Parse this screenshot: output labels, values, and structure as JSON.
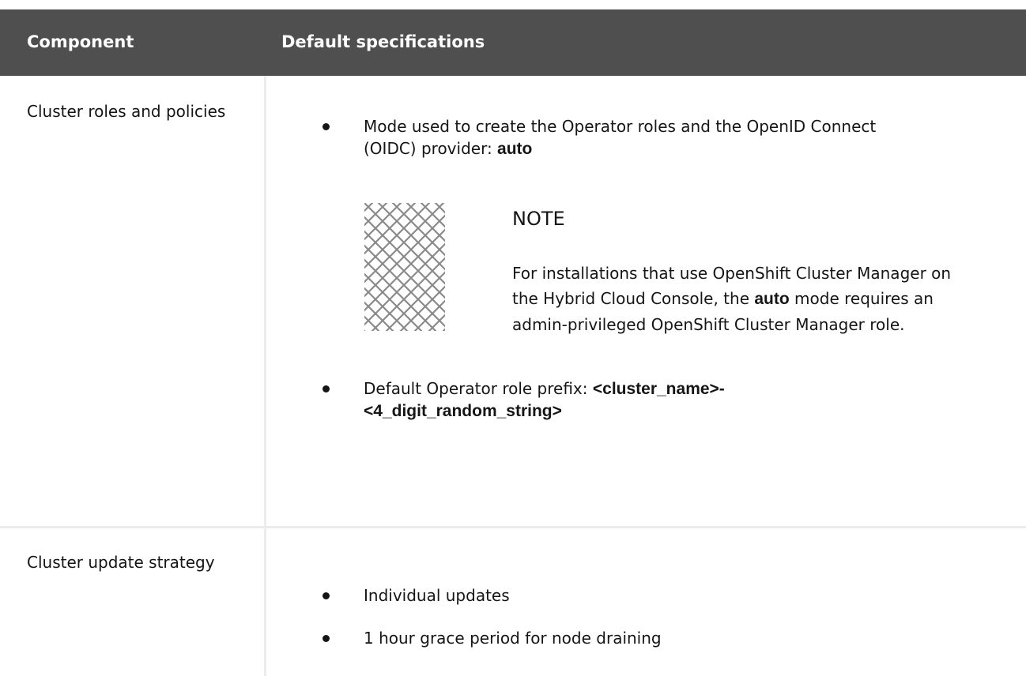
{
  "table": {
    "headers": {
      "component": "Component",
      "default_specifications": "Default specifications"
    },
    "rows": [
      {
        "component": "Cluster roles and policies",
        "items": [
          {
            "text_line1": "Mode used to create the Operator roles and the OpenID Connect",
            "text_line2_prefix": "(OIDC) provider: ",
            "value": "auto"
          },
          {
            "text": "Default Operator role prefix: ",
            "value_line1": "<cluster_name>-",
            "value_line2": "<4_digit_random_string>"
          }
        ],
        "note": {
          "icon": "note-icon",
          "title": "NOTE",
          "line1": "For installations that use OpenShift Cluster Manager on",
          "line2_prefix": "the Hybrid Cloud Console, the ",
          "line2_strong": "auto",
          "line2_suffix": " mode requires an",
          "line3": "admin-privileged OpenShift Cluster Manager role."
        }
      },
      {
        "component": "Cluster update strategy",
        "items": [
          {
            "text": "Individual updates"
          },
          {
            "text": "1 hour grace period for node draining"
          }
        ]
      }
    ]
  },
  "colors": {
    "header_bg": "#4f4f4f",
    "header_text": "#ffffff",
    "grid_line": "#ececec",
    "text": "#151515"
  }
}
